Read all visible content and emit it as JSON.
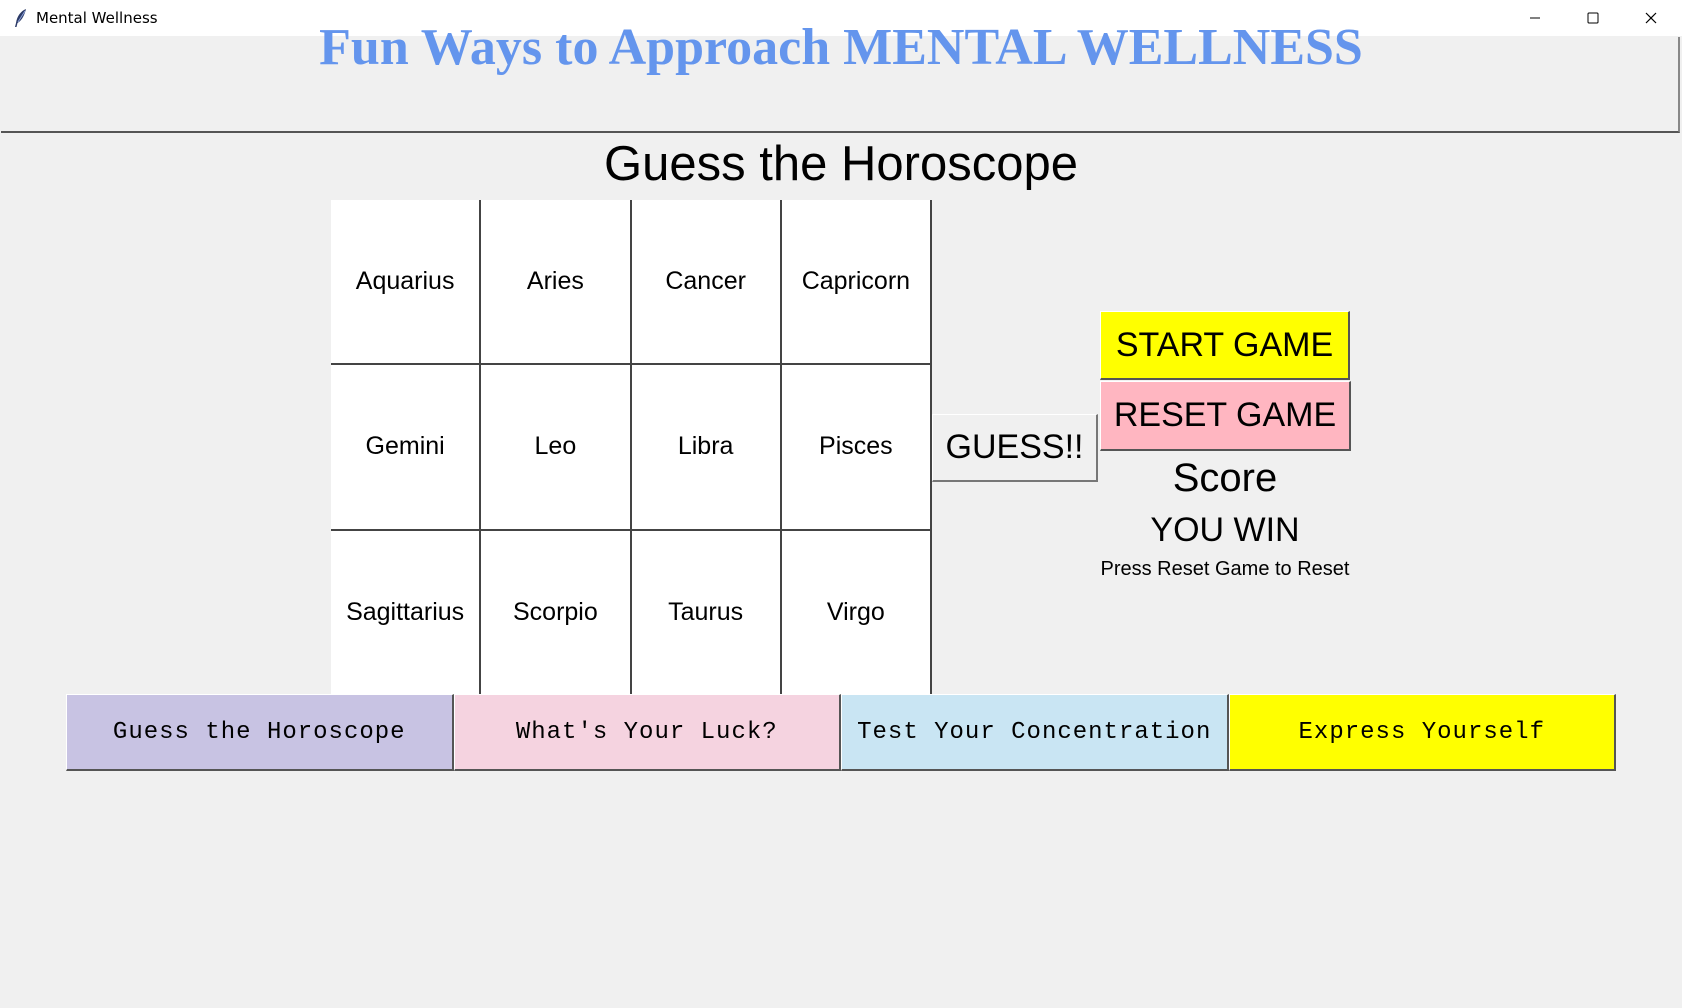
{
  "window": {
    "title": "Mental Wellness"
  },
  "banner": {
    "title": "Fun Ways to Approach MENTAL WELLNESS",
    "color": "#6495ed"
  },
  "game": {
    "title": "Guess the Horoscope",
    "signs": [
      "Aquarius",
      "Aries",
      "Cancer",
      "Capricorn",
      "Gemini",
      "Leo",
      "Libra",
      "Pisces",
      "Sagittarius",
      "Scorpio",
      "Taurus",
      "Virgo"
    ],
    "guess_label": "GUESS!!",
    "start_label": "START GAME",
    "reset_label": "RESET GAME",
    "score_label": "Score",
    "result": "YOU WIN",
    "hint": "Press Reset Game to Reset",
    "colors": {
      "start": "#ffff00",
      "reset": "#ffb6c1"
    }
  },
  "nav": [
    {
      "label": "Guess the Horoscope",
      "color": "#c8c3e3"
    },
    {
      "label": "What's Your Luck?",
      "color": "#f5d3e0"
    },
    {
      "label": "Test Your Concentration",
      "color": "#c9e5f3"
    },
    {
      "label": "Express Yourself",
      "color": "#ffff00"
    }
  ]
}
